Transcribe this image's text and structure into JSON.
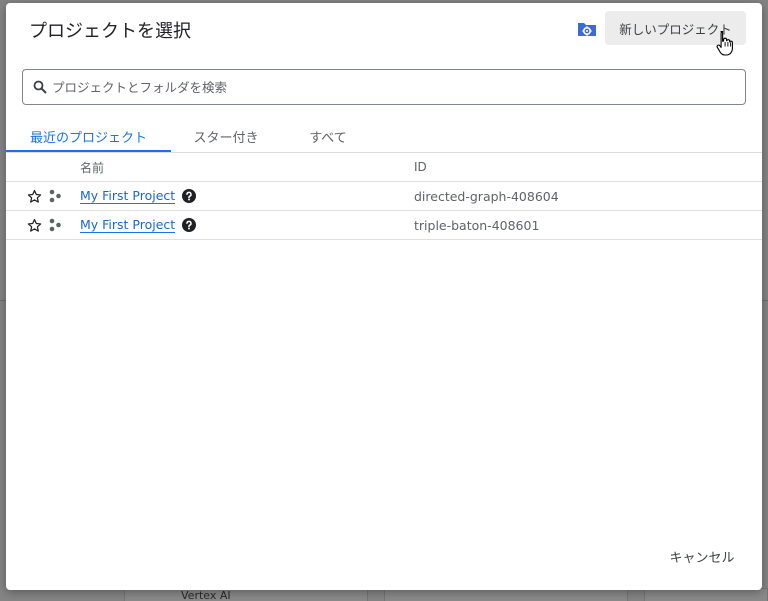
{
  "dialog": {
    "title": "プロジェクトを選択",
    "new_project_label": "新しいプロジェクト",
    "search_placeholder": "プロジェクトとフォルダを検索",
    "search_value": "",
    "tabs": [
      {
        "label": "最近のプロジェクト",
        "active": true
      },
      {
        "label": "スター付き",
        "active": false
      },
      {
        "label": "すべて",
        "active": false
      }
    ],
    "columns": {
      "name": "名前",
      "id": "ID"
    },
    "rows": [
      {
        "name": "My First Project",
        "id": "directed-graph-408604"
      },
      {
        "name": "My First Project",
        "id": "triple-baton-408601"
      }
    ],
    "cancel_label": "キャンセル"
  },
  "background": {
    "fragment_bottom": "Vertex AI"
  },
  "colors": {
    "accent": "#1a73e8",
    "folder_icon": "#3c6bd1",
    "button_bg": "#ececec",
    "overlay": "#858585"
  },
  "icons": [
    "search-icon",
    "folder-settings-icon",
    "star-outline-icon",
    "organization-icon",
    "help-circle-icon",
    "hand-pointer-icon"
  ]
}
